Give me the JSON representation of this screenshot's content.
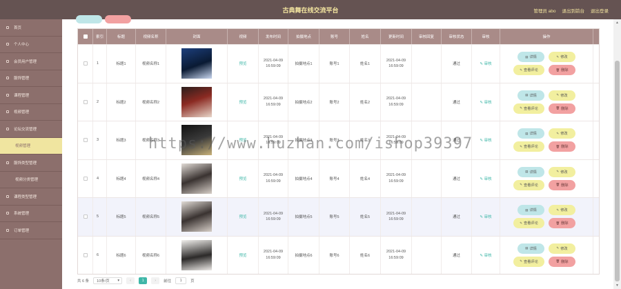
{
  "header": {
    "title": "古典舞在线交流平台",
    "admin": "管理员 abo",
    "back_to_front": "退出到前台",
    "logout": "退出登录"
  },
  "sidebar": {
    "items": [
      {
        "label": "首页",
        "type": "main",
        "active": false
      },
      {
        "label": "个人中心",
        "type": "main",
        "active": false
      },
      {
        "label": "会员用户管理",
        "type": "main",
        "active": false
      },
      {
        "label": "服饰管理",
        "type": "main",
        "active": false
      },
      {
        "label": "课程管理",
        "type": "main",
        "active": false
      },
      {
        "label": "视频管理",
        "type": "main",
        "active": false
      },
      {
        "label": "论坛交流管理",
        "type": "main",
        "active": false
      },
      {
        "label": "视频管理",
        "type": "sub",
        "active": true
      },
      {
        "label": "服饰类型管理",
        "type": "main",
        "active": false
      },
      {
        "label": "视频分类管理",
        "type": "sub",
        "active": false
      },
      {
        "label": "课程类型管理",
        "type": "main",
        "active": false
      },
      {
        "label": "系统管理",
        "type": "main",
        "active": false
      },
      {
        "label": "订单管理",
        "type": "main",
        "active": false
      }
    ]
  },
  "table": {
    "columns": [
      "",
      "索引",
      "标题",
      "视频名称",
      "封面",
      "视频",
      "发布时间",
      "拍摄地点",
      "账号",
      "姓名",
      "更新时间",
      "审核回复",
      "审核状态",
      "审核",
      "操作"
    ],
    "rows": [
      {
        "index": "1",
        "title": "标题1",
        "video_name": "视频名称1",
        "cover": "p1",
        "video": "预览",
        "publish_date": "2021-04-09",
        "publish_time": "16:59:09",
        "location": "拍摄地点1",
        "account": "账号1",
        "name": "姓名1",
        "update_date": "2021-04-09",
        "update_time": "16:59:09",
        "reply": "",
        "status": "通过",
        "audit": "审核"
      },
      {
        "index": "2",
        "title": "标题2",
        "video_name": "视频名称2",
        "cover": "p2",
        "video": "预览",
        "publish_date": "2021-04-09",
        "publish_time": "16:59:09",
        "location": "拍摄地点2",
        "account": "账号2",
        "name": "姓名2",
        "update_date": "2021-04-09",
        "update_time": "16:59:09",
        "reply": "",
        "status": "通过",
        "audit": "审核"
      },
      {
        "index": "3",
        "title": "标题3",
        "video_name": "视频名称3",
        "cover": "p3",
        "video": "预览",
        "publish_date": "2021-04-09",
        "publish_time": "16:59:09",
        "location": "拍摄地点3",
        "account": "账号3",
        "name": "姓名3",
        "update_date": "2021-04-09",
        "update_time": "16:59:09",
        "reply": "",
        "status": "通过",
        "audit": "审核"
      },
      {
        "index": "4",
        "title": "标题4",
        "video_name": "视频名称4",
        "cover": "p4",
        "video": "预览",
        "publish_date": "2021-04-09",
        "publish_time": "16:59:09",
        "location": "拍摄地点4",
        "account": "账号4",
        "name": "姓名4",
        "update_date": "2021-04-09",
        "update_time": "16:59:09",
        "reply": "",
        "status": "通过",
        "audit": "审核"
      },
      {
        "index": "5",
        "title": "标题5",
        "video_name": "视频名称5",
        "cover": "p4",
        "video": "预览",
        "publish_date": "2021-04-09",
        "publish_time": "16:59:09",
        "location": "拍摄地点5",
        "account": "账号5",
        "name": "姓名5",
        "update_date": "2021-04-09",
        "update_time": "16:59:09",
        "reply": "",
        "status": "通过",
        "audit": "审核"
      },
      {
        "index": "6",
        "title": "标题6",
        "video_name": "视频名称6",
        "cover": "p6",
        "video": "预览",
        "publish_date": "2021-04-09",
        "publish_time": "16:59:09",
        "location": "拍摄地点6",
        "account": "账号6",
        "name": "姓名6",
        "update_date": "2021-04-09",
        "update_time": "16:59:09",
        "reply": "",
        "status": "通过",
        "audit": "审核"
      }
    ],
    "actions": {
      "detail": "详情",
      "edit": "修改",
      "comment": "查看评论",
      "delete": "删除"
    }
  },
  "pager": {
    "total": "共 6 条",
    "page_size": "10条/页",
    "current_page": "1",
    "goto_prefix": "前往",
    "goto_value": "1",
    "goto_suffix": "页"
  },
  "watermark": "https://www.huzhan.com/ishop39397",
  "colors": {
    "header_bg": "#655352",
    "sidebar_bg": "#8c6f6c",
    "active_item": "#f0e5a0",
    "table_head": "#a98b88",
    "accent": "#3fb7a8"
  }
}
